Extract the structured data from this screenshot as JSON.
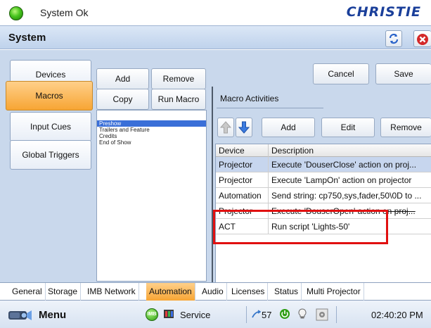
{
  "header": {
    "status_text": "System Ok",
    "logo_text": "CHRISTIE"
  },
  "titlebar": {
    "title": "System"
  },
  "side_tabs": [
    {
      "label": "Devices",
      "active": false
    },
    {
      "label": "Macros",
      "active": true
    },
    {
      "label": "Input Cues",
      "active": false
    },
    {
      "label": "Global Triggers",
      "active": false
    }
  ],
  "macro_buttons": {
    "add": "Add",
    "remove": "Remove",
    "copy": "Copy",
    "run_macro": "Run Macro"
  },
  "macros": [
    {
      "name": "Preshow",
      "selected": true
    },
    {
      "name": "Trailers and Feature",
      "selected": false
    },
    {
      "name": "Credits",
      "selected": false
    },
    {
      "name": "End of Show",
      "selected": false
    }
  ],
  "top_buttons": {
    "cancel": "Cancel",
    "save": "Save"
  },
  "activities": {
    "section_title": "Macro Activities",
    "add": "Add",
    "edit": "Edit",
    "remove": "Remove",
    "columns": [
      "Device",
      "Description"
    ],
    "rows": [
      {
        "device": "Projector",
        "description": "Execute 'DouserClose' action on proj...",
        "selected": true,
        "strike": false
      },
      {
        "device": "Projector",
        "description": "Execute 'LampOn' action on projector",
        "selected": false,
        "strike": false
      },
      {
        "device": "Automation",
        "description": "Send string: cp750,sys,fader,50\\0D to ...",
        "selected": false,
        "strike": false
      },
      {
        "device": "Projector",
        "description": "Execute 'DouserOpen' action on proj...",
        "selected": false,
        "strike": true
      },
      {
        "device": "ACT",
        "description": "Run script 'Lights-50'",
        "selected": false,
        "strike": false
      }
    ]
  },
  "bottom_tabs": [
    {
      "label": "General",
      "active": false
    },
    {
      "label": "Storage",
      "active": false
    },
    {
      "label": "IMB Network",
      "active": false
    },
    {
      "label": "Automation",
      "active": true
    },
    {
      "label": "Audio",
      "active": false
    },
    {
      "label": "Licenses",
      "active": false
    },
    {
      "label": "Status",
      "active": false
    },
    {
      "label": "Multi Projector",
      "active": false
    }
  ],
  "statusbar": {
    "menu_label": "Menu",
    "imb_label": "IMB",
    "service_label": "Service",
    "count": "57",
    "time": "02:40:20 PM"
  },
  "colors": {
    "accent_orange": "#f7a534",
    "selection_blue": "#3a6fd8",
    "highlight_red": "#e11010",
    "brand_blue": "#1a3f9a"
  }
}
